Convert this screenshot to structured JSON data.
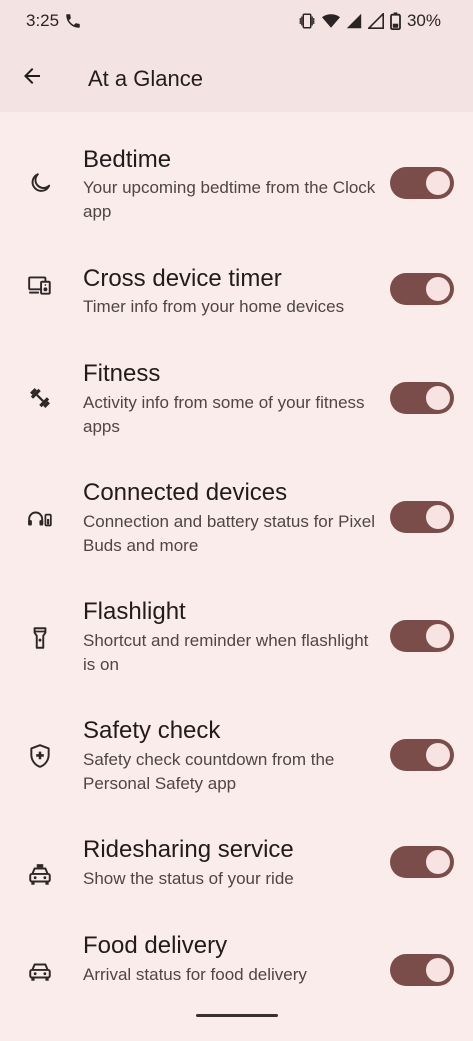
{
  "status_bar": {
    "time": "3:25",
    "battery": "30%",
    "icons": [
      "phone-call-icon",
      "vibrate-icon",
      "wifi-icon",
      "signal-icon",
      "signal-icon",
      "battery-icon"
    ]
  },
  "app_bar": {
    "title": "At a Glance",
    "back_icon": "back-arrow-icon"
  },
  "items": [
    {
      "title": "Bedtime",
      "subtitle": "Your upcoming bedtime from the Clock app",
      "icon": "moon-icon",
      "enabled": true
    },
    {
      "title": "Cross device timer",
      "subtitle": "Timer info from your home devices",
      "icon": "devices-icon",
      "enabled": true
    },
    {
      "title": "Fitness",
      "subtitle": "Activity info from some of your fitness apps",
      "icon": "dumbbell-icon",
      "enabled": true
    },
    {
      "title": "Connected devices",
      "subtitle": "Connection and battery status for Pixel Buds and more",
      "icon": "earbuds-battery-icon",
      "enabled": true
    },
    {
      "title": "Flashlight",
      "subtitle": "Shortcut and reminder when flashlight is on",
      "icon": "flashlight-icon",
      "enabled": true
    },
    {
      "title": "Safety check",
      "subtitle": "Safety check countdown from the Personal Safety app",
      "icon": "shield-plus-icon",
      "enabled": true
    },
    {
      "title": "Ridesharing service",
      "subtitle": "Show the status of your ride",
      "icon": "taxi-icon",
      "enabled": true
    },
    {
      "title": "Food delivery",
      "subtitle": "Arrival status for food delivery",
      "icon": "car-icon",
      "enabled": true
    }
  ],
  "colors": {
    "background": "#faeceb",
    "header": "#f3e3e2",
    "toggle_on": "#7b4d4a",
    "toggle_knob": "#f7e3e1",
    "title_text": "#221b1b",
    "subtitle_text": "#4f4545"
  }
}
